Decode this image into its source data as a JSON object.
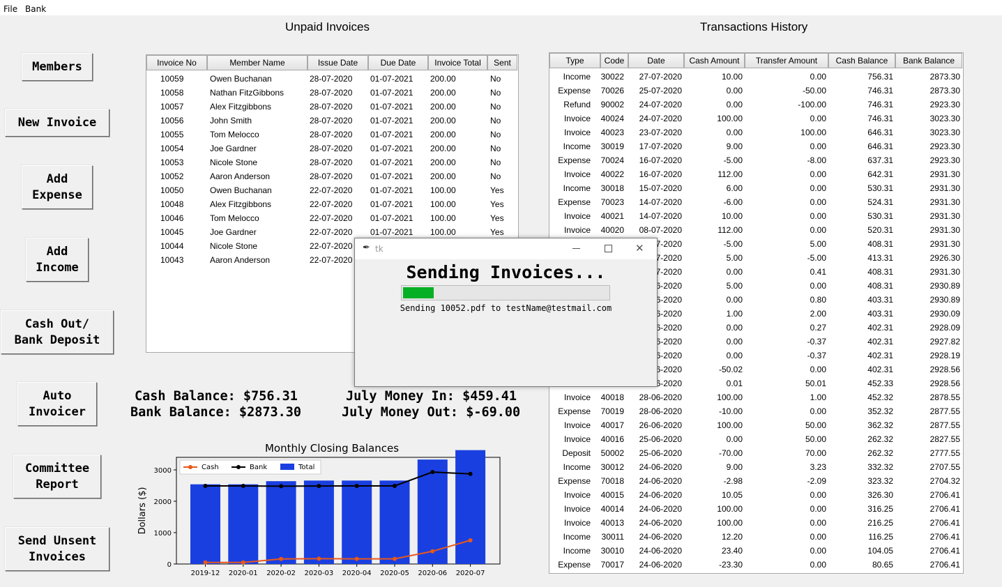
{
  "menu": {
    "file": "File",
    "bank": "Bank"
  },
  "sidebar": {
    "members": "Members",
    "new_invoice": "New Invoice",
    "add_expense": "Add\nExpense",
    "add_income": "Add\nIncome",
    "cash_out": "Cash Out/\nBank Deposit",
    "auto_invoicer": "Auto\nInvoicer",
    "committee_report": "Committee\nReport",
    "send_unsent": "Send Unsent\nInvoices"
  },
  "invoices": {
    "title": "Unpaid Invoices",
    "columns": [
      "Invoice No",
      "Member Name",
      "Issue Date",
      "Due Date",
      "Invoice Total",
      "Sent"
    ],
    "rows": [
      [
        "10059",
        "Owen Buchanan",
        "28-07-2020",
        "01-07-2021",
        "200.00",
        "No"
      ],
      [
        "10058",
        "Nathan FitzGibbons",
        "28-07-2020",
        "01-07-2021",
        "200.00",
        "No"
      ],
      [
        "10057",
        "Alex Fitzgibbons",
        "28-07-2020",
        "01-07-2021",
        "200.00",
        "No"
      ],
      [
        "10056",
        "John Smith",
        "28-07-2020",
        "01-07-2021",
        "200.00",
        "No"
      ],
      [
        "10055",
        "Tom Melocco",
        "28-07-2020",
        "01-07-2021",
        "200.00",
        "No"
      ],
      [
        "10054",
        "Joe Gardner",
        "28-07-2020",
        "01-07-2021",
        "200.00",
        "No"
      ],
      [
        "10053",
        "Nicole Stone",
        "28-07-2020",
        "01-07-2021",
        "200.00",
        "No"
      ],
      [
        "10052",
        "Aaron Anderson",
        "28-07-2020",
        "01-07-2021",
        "200.00",
        "No"
      ],
      [
        "10050",
        "Owen Buchanan",
        "22-07-2020",
        "01-07-2021",
        "100.00",
        "Yes"
      ],
      [
        "10048",
        "Alex Fitzgibbons",
        "22-07-2020",
        "01-07-2021",
        "100.00",
        "Yes"
      ],
      [
        "10046",
        "Tom Melocco",
        "22-07-2020",
        "01-07-2021",
        "100.00",
        "Yes"
      ],
      [
        "10045",
        "Joe Gardner",
        "22-07-2020",
        "01-07-2021",
        "100.00",
        "Yes"
      ],
      [
        "10044",
        "Nicole Stone",
        "22-07-2020",
        "",
        "",
        ""
      ],
      [
        "10043",
        "Aaron Anderson",
        "22-07-2020",
        "",
        "",
        ""
      ]
    ]
  },
  "balances": {
    "cash": "Cash Balance: $756.31",
    "bank": "Bank Balance: $2873.30",
    "money_in": "July Money In: $459.41",
    "money_out": "July Money Out: $-69.00"
  },
  "transactions": {
    "title": "Transactions History",
    "columns": [
      "Type",
      "Code",
      "Date",
      "Cash Amount",
      "Transfer Amount",
      "Cash Balance",
      "Bank Balance"
    ],
    "rows": [
      [
        "Income",
        "30022",
        "27-07-2020",
        "10.00",
        "0.00",
        "756.31",
        "2873.30"
      ],
      [
        "Expense",
        "70026",
        "25-07-2020",
        "0.00",
        "-50.00",
        "746.31",
        "2873.30"
      ],
      [
        "Refund",
        "90002",
        "24-07-2020",
        "0.00",
        "-100.00",
        "746.31",
        "2923.30"
      ],
      [
        "Invoice",
        "40024",
        "24-07-2020",
        "100.00",
        "0.00",
        "746.31",
        "3023.30"
      ],
      [
        "Invoice",
        "40023",
        "23-07-2020",
        "0.00",
        "100.00",
        "646.31",
        "3023.30"
      ],
      [
        "Income",
        "30019",
        "17-07-2020",
        "9.00",
        "0.00",
        "646.31",
        "2923.30"
      ],
      [
        "Expense",
        "70024",
        "16-07-2020",
        "-5.00",
        "-8.00",
        "637.31",
        "2923.30"
      ],
      [
        "Invoice",
        "40022",
        "16-07-2020",
        "112.00",
        "0.00",
        "642.31",
        "2931.30"
      ],
      [
        "Income",
        "30018",
        "15-07-2020",
        "6.00",
        "0.00",
        "530.31",
        "2931.30"
      ],
      [
        "Expense",
        "70023",
        "14-07-2020",
        "-6.00",
        "0.00",
        "524.31",
        "2931.30"
      ],
      [
        "Invoice",
        "40021",
        "14-07-2020",
        "10.00",
        "0.00",
        "530.31",
        "2931.30"
      ],
      [
        "Invoice",
        "40020",
        "08-07-2020",
        "112.00",
        "0.00",
        "520.31",
        "2931.30"
      ],
      [
        "",
        "",
        "-07-2020",
        "-5.00",
        "5.00",
        "408.31",
        "2931.30"
      ],
      [
        "",
        "",
        "-07-2020",
        "5.00",
        "-5.00",
        "413.31",
        "2926.30"
      ],
      [
        "",
        "",
        "-07-2020",
        "0.00",
        "0.41",
        "408.31",
        "2931.30"
      ],
      [
        "",
        "",
        "-06-2020",
        "5.00",
        "0.00",
        "408.31",
        "2930.89"
      ],
      [
        "",
        "",
        "-06-2020",
        "0.00",
        "0.80",
        "403.31",
        "2930.89"
      ],
      [
        "",
        "",
        "-06-2020",
        "1.00",
        "2.00",
        "403.31",
        "2930.09"
      ],
      [
        "",
        "",
        "-06-2020",
        "0.00",
        "0.27",
        "402.31",
        "2928.09"
      ],
      [
        "",
        "",
        "-06-2020",
        "0.00",
        "-0.37",
        "402.31",
        "2927.82"
      ],
      [
        "",
        "",
        "-06-2020",
        "0.00",
        "-0.37",
        "402.31",
        "2928.19"
      ],
      [
        "",
        "",
        "-06-2020",
        "-50.02",
        "0.00",
        "402.31",
        "2928.56"
      ],
      [
        "",
        "",
        "-06-2020",
        "0.01",
        "50.01",
        "452.33",
        "2928.56"
      ],
      [
        "Invoice",
        "40018",
        "28-06-2020",
        "100.00",
        "1.00",
        "452.32",
        "2878.55"
      ],
      [
        "Expense",
        "70019",
        "28-06-2020",
        "-10.00",
        "0.00",
        "352.32",
        "2877.55"
      ],
      [
        "Invoice",
        "40017",
        "26-06-2020",
        "100.00",
        "50.00",
        "362.32",
        "2877.55"
      ],
      [
        "Invoice",
        "40016",
        "25-06-2020",
        "0.00",
        "50.00",
        "262.32",
        "2827.55"
      ],
      [
        "Deposit",
        "50002",
        "25-06-2020",
        "-70.00",
        "70.00",
        "262.32",
        "2777.55"
      ],
      [
        "Income",
        "30012",
        "24-06-2020",
        "9.00",
        "3.23",
        "332.32",
        "2707.55"
      ],
      [
        "Expense",
        "70018",
        "24-06-2020",
        "-2.98",
        "-2.09",
        "323.32",
        "2704.32"
      ],
      [
        "Invoice",
        "40015",
        "24-06-2020",
        "10.05",
        "0.00",
        "326.30",
        "2706.41"
      ],
      [
        "Invoice",
        "40014",
        "24-06-2020",
        "100.00",
        "0.00",
        "316.25",
        "2706.41"
      ],
      [
        "Invoice",
        "40013",
        "24-06-2020",
        "100.00",
        "0.00",
        "216.25",
        "2706.41"
      ],
      [
        "Income",
        "30011",
        "24-06-2020",
        "12.20",
        "0.00",
        "116.25",
        "2706.41"
      ],
      [
        "Income",
        "30010",
        "24-06-2020",
        "23.40",
        "0.00",
        "104.05",
        "2706.41"
      ],
      [
        "Expense",
        "70017",
        "24-06-2020",
        "-23.30",
        "0.00",
        "80.65",
        "2706.41"
      ]
    ]
  },
  "popup": {
    "window_title": "tk",
    "heading": "Sending Invoices...",
    "progress": 0.15,
    "status": "Sending 10052.pdf to testName@testmail.com"
  },
  "chart_data": {
    "type": "bar",
    "title": "Monthly Closing Balances",
    "ylabel": "Dollars ($)",
    "xlabel": "",
    "categories": [
      "2019-12",
      "2020-01",
      "2020-02",
      "2020-03",
      "2020-04",
      "2020-05",
      "2020-06",
      "2020-07"
    ],
    "ylim": [
      0,
      3400
    ],
    "yticks": [
      0,
      1000,
      2000,
      3000
    ],
    "legend": {
      "position": "top-left"
    },
    "series": [
      {
        "name": "Total",
        "kind": "bar",
        "color": "#1a3fe0",
        "values": [
          2540,
          2540,
          2640,
          2660,
          2660,
          2660,
          3330,
          3630
        ]
      },
      {
        "name": "Cash",
        "kind": "line",
        "color": "#e8581c",
        "values": [
          50,
          50,
          160,
          170,
          165,
          165,
          405,
          756
        ]
      },
      {
        "name": "Bank",
        "kind": "line",
        "color": "#000000",
        "values": [
          2490,
          2490,
          2480,
          2485,
          2490,
          2490,
          2930,
          2873
        ]
      }
    ]
  }
}
